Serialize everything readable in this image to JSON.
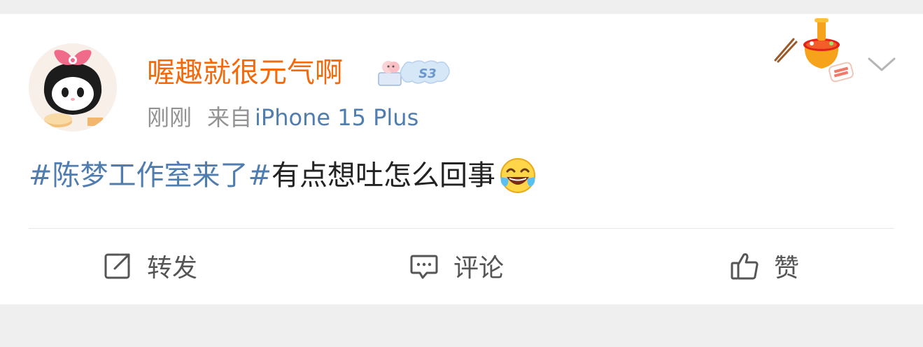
{
  "post": {
    "username": "喔趣就很元气啊",
    "badge_text": "S3",
    "time": "刚刚",
    "from_label": "来自",
    "device": "iPhone 15 Plus",
    "topic": "#陈梦工作室来了#",
    "text": "有点想吐怎么回事",
    "emoji_name": "laugh-cry-emoji"
  },
  "actions": {
    "repost_label": "转发",
    "comment_label": "评论",
    "like_label": "赞"
  },
  "colors": {
    "username": "#f36a0c",
    "link": "#507daf",
    "meta": "#939393",
    "text": "#222222"
  },
  "icons": [
    "avatar",
    "sticker-badge-icon",
    "hotpot-decoration-icon",
    "chevron-down-icon",
    "repost-icon",
    "comment-icon",
    "thumbs-up-icon"
  ]
}
